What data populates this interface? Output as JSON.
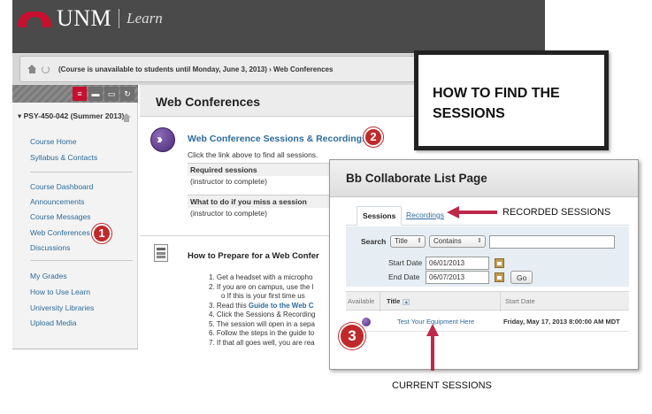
{
  "header": {
    "logo_text": "UNM",
    "logo_sub": "Learn"
  },
  "breadcrumb": {
    "text": "(Course is unavailable to students until Monday, June 3, 2013) › Web Conferences"
  },
  "sidebar": {
    "course_title": "PSY-450-042 (Summer 2013)",
    "links": [
      {
        "label": "Course Home"
      },
      {
        "label": "Syllabus & Contacts"
      },
      {
        "label": "Course Dashboard"
      },
      {
        "label": "Announcements"
      },
      {
        "label": "Course Messages"
      },
      {
        "label": "Web Conferences"
      },
      {
        "label": "Discussions"
      },
      {
        "label": "My Grades"
      },
      {
        "label": "How to Use Learn"
      },
      {
        "label": "University Libraries"
      },
      {
        "label": "Upload Media"
      }
    ]
  },
  "main": {
    "title": "Web Conferences",
    "conf_link": "Web Conference Sessions & Recordings",
    "conf_desc": "Click the link above to find all sessions.",
    "required_head": "Required sessions",
    "required_sub": "(instructor to complete)",
    "missed_head": "What to do if you miss a session",
    "missed_sub": "(instructor to complete)",
    "prep_title": "How to Prepare for a Web Confer",
    "steps": [
      "1.  Get a headset with a micropho",
      "2.  If you are on campus, use the l",
      "o  If this is your first time us",
      "3.  Read this ",
      "Guide to the Web C",
      "4.  Click the Sessions & Recording",
      "5.  The session will open in a sepa",
      "6.  Follow the steps in the guide to",
      "7.  If that all goes well, you are rea"
    ]
  },
  "callout": {
    "text": "HOW TO FIND THE\nSESSIONS"
  },
  "bb": {
    "title": "Bb Collaborate List Page",
    "tab_sessions": "Sessions",
    "tab_recordings": "Recordings",
    "search_label": "Search",
    "search_field": "Title",
    "search_op": "Contains",
    "start_label": "Start Date",
    "start_value": "06/01/2013",
    "end_label": "End Date",
    "end_value": "06/07/2013",
    "go_label": "Go",
    "col_available": "Available",
    "col_title": "Title",
    "col_start": "Start Date",
    "row_title": "Test Your Equipment Here",
    "row_date": "Friday, May 17, 2013 8:00:00 AM MDT"
  },
  "annotations": {
    "badge1": "1",
    "badge2": "2",
    "badge3": "3",
    "recorded": "RECORDED SESSIONS",
    "current": "CURRENT SESSIONS"
  },
  "colors": {
    "unm_red": "#c8102e",
    "badge_red": "#c0292b",
    "arrow_red": "#c0284a",
    "link_blue": "#2c6b9a"
  }
}
